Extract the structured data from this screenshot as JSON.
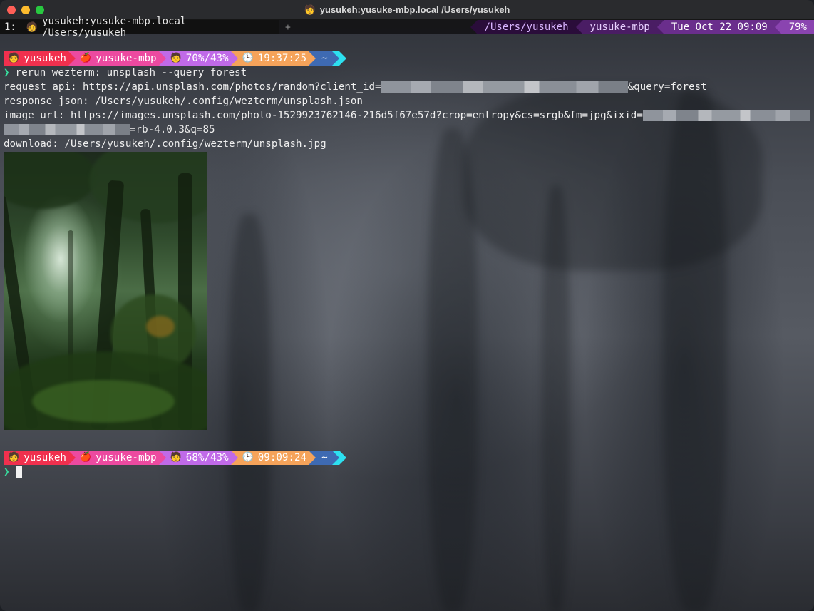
{
  "window": {
    "title": "yusukeh:yusuke-mbp.local /Users/yusukeh",
    "title_icon": "person-emoji"
  },
  "tabbar": {
    "active_tab": {
      "index": "1:",
      "icon": "person-emoji",
      "label": "yusukeh:yusuke-mbp.local /Users/yusukeh"
    },
    "new_tab_label": "+",
    "status": {
      "cwd": "/Users/yusukeh",
      "host": "yusuke-mbp",
      "datetime": "Tue Oct 22 09:09",
      "battery": "79%"
    }
  },
  "prompts": [
    {
      "user": "yusukeh",
      "host": "yusuke-mbp",
      "battery": "70%/43%",
      "time": "19:37:25",
      "dir": "~"
    },
    {
      "user": "yusukeh",
      "host": "yusuke-mbp",
      "battery": "68%/43%",
      "time": "09:09:24",
      "dir": "~"
    }
  ],
  "output": {
    "prompt_symbol": "❯",
    "command": "rerun wezterm: unsplash --query forest",
    "request_api_prefix": "request api: https://api.unsplash.com/photos/random?client_id=",
    "request_api_suffix": "&query=forest",
    "response_json": "response json: /Users/yusukeh/.config/wezterm/unsplash.json",
    "image_url_prefix": "image url: https://images.unsplash.com/photo-1529923762146-216d5f67e57d?crop=entropy&cs=srgb&fm=jpg&ixid=",
    "image_url_suffix": "=rb-4.0.3&q=85",
    "download": "download: /Users/yusukeh/.config/wezterm/unsplash.jpg"
  },
  "colors": {
    "user_segment": "#f0304e",
    "host_segment": "#ec4aa0",
    "battery_segment": "#c06ae8",
    "time_segment": "#f5a35a",
    "dir_segment": "#3e6ab2",
    "prompt_arrow": "#38e0a0"
  }
}
